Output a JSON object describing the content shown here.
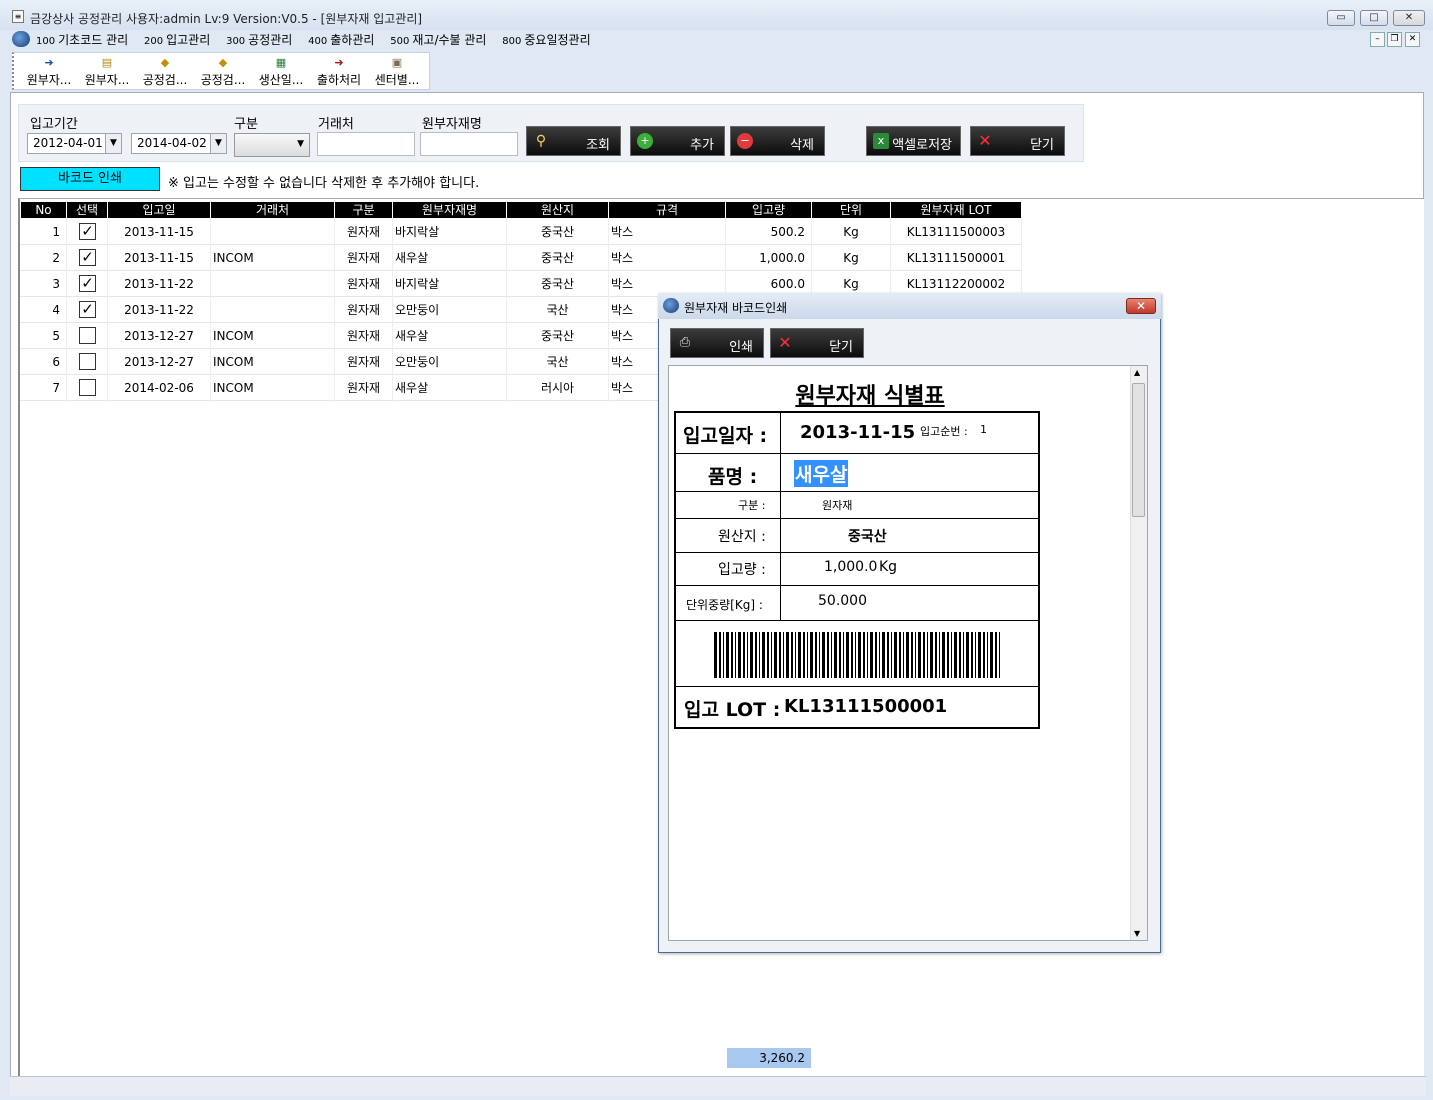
{
  "window": {
    "title": "금강상사 공정관리 사용자:admin Lv:9  Version:V0.5 - [원부자재 입고관리]",
    "min_label": "▭",
    "max_label": "□",
    "close_label": "✕"
  },
  "menu": [
    {
      "num": "100",
      "label": "기초코드 관리"
    },
    {
      "num": "200",
      "label": "입고관리"
    },
    {
      "num": "300",
      "label": "공정관리"
    },
    {
      "num": "400",
      "label": "출하관리"
    },
    {
      "num": "500",
      "label": "재고/수불 관리"
    },
    {
      "num": "800",
      "label": "중요일정관리"
    }
  ],
  "toolbar": [
    {
      "label": "원부자...",
      "icon": "login-icon"
    },
    {
      "label": "원부자...",
      "icon": "document-icon"
    },
    {
      "label": "공정검...",
      "icon": "box-icon"
    },
    {
      "label": "공정검...",
      "icon": "box-icon"
    },
    {
      "label": "생산일...",
      "icon": "calendar-icon"
    },
    {
      "label": "출하처리",
      "icon": "login-icon"
    },
    {
      "label": "센터별...",
      "icon": "package-icon"
    }
  ],
  "filters": {
    "period_label": "입고기간",
    "date_from": "2012-04-01",
    "date_to": "2014-04-02",
    "type_label": "구분",
    "type_value": "",
    "vendor_label": "거래처",
    "vendor_value": "",
    "material_label": "원부자재명",
    "material_value": ""
  },
  "actions": {
    "search": "조회",
    "add": "추가",
    "delete": "삭제",
    "excel": "액셀로저장",
    "close": "닫기"
  },
  "barcode_button": "바코드 인쇄",
  "notice": "※ 입고는 수정할 수 없습니다 삭제한 후 추가해야 합니다.",
  "table": {
    "columns": [
      "No",
      "선택",
      "입고일",
      "거래처",
      "구분",
      "원부자재명",
      "원산지",
      "규격",
      "입고량",
      "단위",
      "원부자재 LOT"
    ],
    "rows": [
      {
        "no": "1",
        "checked": true,
        "date": "2013-11-15",
        "vendor": "",
        "type": "원자재",
        "name": "바지락살",
        "origin": "중국산",
        "spec": "박스",
        "qty": "500.2",
        "unit": "Kg",
        "lot": "KL13111500003"
      },
      {
        "no": "2",
        "checked": true,
        "date": "2013-11-15",
        "vendor": "INCOM",
        "type": "원자재",
        "name": "새우살",
        "origin": "중국산",
        "spec": "박스",
        "qty": "1,000.0",
        "unit": "Kg",
        "lot": "KL13111500001"
      },
      {
        "no": "3",
        "checked": true,
        "date": "2013-11-22",
        "vendor": "",
        "type": "원자재",
        "name": "바지락살",
        "origin": "중국산",
        "spec": "박스",
        "qty": "600.0",
        "unit": "Kg",
        "lot": "KL13112200002"
      },
      {
        "no": "4",
        "checked": true,
        "date": "2013-11-22",
        "vendor": "",
        "type": "원자재",
        "name": "오만둥이",
        "origin": "국산",
        "spec": "박스",
        "qty": "",
        "unit": "",
        "lot": ""
      },
      {
        "no": "5",
        "checked": false,
        "date": "2013-12-27",
        "vendor": "INCOM",
        "type": "원자재",
        "name": "새우살",
        "origin": "중국산",
        "spec": "박스",
        "qty": "",
        "unit": "",
        "lot": ""
      },
      {
        "no": "6",
        "checked": false,
        "date": "2013-12-27",
        "vendor": "INCOM",
        "type": "원자재",
        "name": "오만둥이",
        "origin": "국산",
        "spec": "박스",
        "qty": "",
        "unit": "",
        "lot": ""
      },
      {
        "no": "7",
        "checked": false,
        "date": "2014-02-06",
        "vendor": "INCOM",
        "type": "원자재",
        "name": "새우살",
        "origin": "러시아",
        "spec": "박스",
        "qty": "",
        "unit": "",
        "lot": ""
      }
    ],
    "total": "3,260.2"
  },
  "dialog": {
    "title": "원부자재 바코드인쇄",
    "print": "인쇄",
    "close": "닫기",
    "label": {
      "title": "원부자재 식별표",
      "date_label": "입고일자 :",
      "date_value": "2013-11-15",
      "seq_label": "입고순번 :",
      "seq_value": "1",
      "name_label": "품명 :",
      "name_value": "새우살",
      "type_label": "구분 :",
      "type_value": "원자재",
      "origin_label": "원산지 :",
      "origin_value": "중국산",
      "qty_label": "입고량 :",
      "qty_value": "1,000.0",
      "qty_unit": "Kg",
      "unitweight_label": "단위중량[Kg] :",
      "unitweight_value": "50.000",
      "lot_label": "입고 LOT :",
      "lot_value": "KL13111500001"
    }
  }
}
